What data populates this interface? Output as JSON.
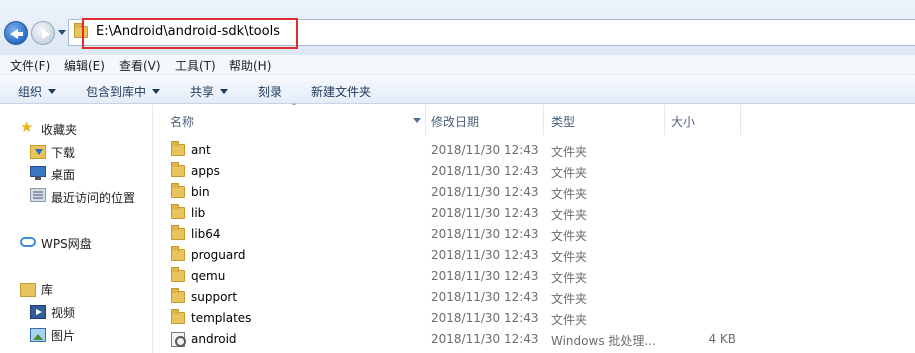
{
  "address": {
    "path": "E:\\Android\\android-sdk\\tools"
  },
  "menu": [
    "文件(F)",
    "编辑(E)",
    "查看(V)",
    "工具(T)",
    "帮助(H)"
  ],
  "toolbar": {
    "organize": "组织",
    "include_in_library": "包含到库中",
    "share": "共享",
    "burn": "刻录",
    "new_folder": "新建文件夹"
  },
  "nav": {
    "favorites": "收藏夹",
    "downloads": "下载",
    "desktop": "桌面",
    "recent": "最近访问的位置",
    "wps": "WPS网盘",
    "libraries": "库",
    "videos": "视频",
    "pictures": "图片"
  },
  "columns": {
    "name": "名称",
    "modified": "修改日期",
    "type": "类型",
    "size": "大小"
  },
  "files": [
    {
      "name": "ant",
      "date": "2018/11/30 12:43",
      "type": "文件夹",
      "size": "",
      "icon": "folder-icon"
    },
    {
      "name": "apps",
      "date": "2018/11/30 12:43",
      "type": "文件夹",
      "size": "",
      "icon": "folder-icon"
    },
    {
      "name": "bin",
      "date": "2018/11/30 12:43",
      "type": "文件夹",
      "size": "",
      "icon": "folder-icon"
    },
    {
      "name": "lib",
      "date": "2018/11/30 12:43",
      "type": "文件夹",
      "size": "",
      "icon": "folder-icon"
    },
    {
      "name": "lib64",
      "date": "2018/11/30 12:43",
      "type": "文件夹",
      "size": "",
      "icon": "folder-icon"
    },
    {
      "name": "proguard",
      "date": "2018/11/30 12:43",
      "type": "文件夹",
      "size": "",
      "icon": "folder-icon"
    },
    {
      "name": "qemu",
      "date": "2018/11/30 12:43",
      "type": "文件夹",
      "size": "",
      "icon": "folder-icon"
    },
    {
      "name": "support",
      "date": "2018/11/30 12:43",
      "type": "文件夹",
      "size": "",
      "icon": "folder-icon"
    },
    {
      "name": "templates",
      "date": "2018/11/30 12:43",
      "type": "文件夹",
      "size": "",
      "icon": "folder-icon"
    },
    {
      "name": "android",
      "date": "2018/11/30 12:43",
      "type": "Windows 批处理...",
      "size": "4 KB",
      "icon": "batch-file-icon"
    }
  ],
  "colors": {
    "highlight_border": "#e02d2d",
    "folder": "#e8c35e"
  }
}
